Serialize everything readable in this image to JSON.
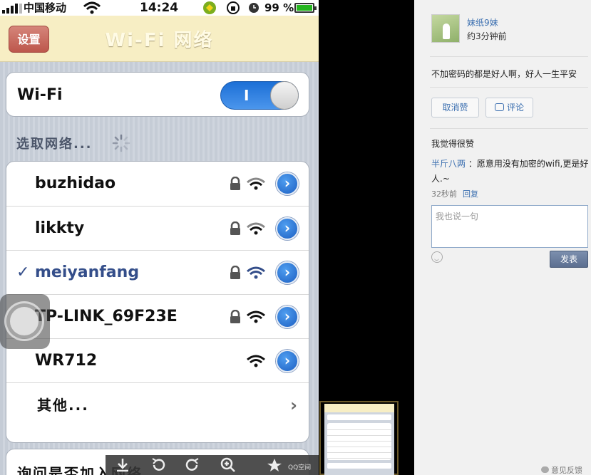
{
  "status_bar": {
    "carrier": "中国移动",
    "time": "14:24",
    "battery": "99 %",
    "battery_level": 0.99,
    "icons": [
      "signal-bars-icon",
      "wifi-icon",
      "app-badge-icon",
      "rotation-lock-icon",
      "alarm-icon",
      "battery-icon"
    ]
  },
  "nav": {
    "back_label": "设置",
    "title": "Wi-Fi 网络"
  },
  "wifi_toggle": {
    "label": "Wi-Fi",
    "state_label": "I",
    "on": true
  },
  "networks_section": {
    "label": "选取网络...",
    "spinner_icon": "loading-spinner-icon",
    "networks": [
      {
        "name": "buzhidao",
        "locked": true,
        "connected": false
      },
      {
        "name": "likkty",
        "locked": true,
        "connected": false
      },
      {
        "name": "meiyanfang",
        "locked": true,
        "connected": true
      },
      {
        "name": "TP-LINK_69F23E",
        "locked": true,
        "connected": false
      },
      {
        "name": "WR712",
        "locked": false,
        "connected": false
      }
    ],
    "check_mark": "✓",
    "detail_arrow": "›",
    "other_label": "其他...",
    "other_chevron": "›"
  },
  "ask_join": {
    "label": "询问是否加入网络"
  },
  "toolbar": {
    "icons": [
      "download-icon",
      "rotate-left-icon",
      "rotate-right-icon",
      "zoom-icon",
      "share-icon"
    ],
    "qzone_label": "QQ空间"
  },
  "side": {
    "author": "妹纸9妹",
    "time": "约3分钟前",
    "post_text": "不加密码的都是好人啊，好人一生平安",
    "unlike_label": "取消赞",
    "comment_label": "评论",
    "likes_text": "我觉得很赞",
    "comment": {
      "author": "半斤八两",
      "separator": " ：",
      "text": "愿意用没有加密的wifi,更是好人.~",
      "time": "32秒前",
      "reply_label": "回复"
    },
    "reply_placeholder": "我也说一句",
    "send_label": "发表",
    "feedback_label": "意见反馈"
  },
  "colors": {
    "nav_bg": "#f7eec4",
    "back_button": "#c9665b",
    "toggle_blue": "#2a7be0",
    "link_blue": "#3b6fb0",
    "selected_network": "#344e8a",
    "send_button": "#6b7d9c"
  }
}
